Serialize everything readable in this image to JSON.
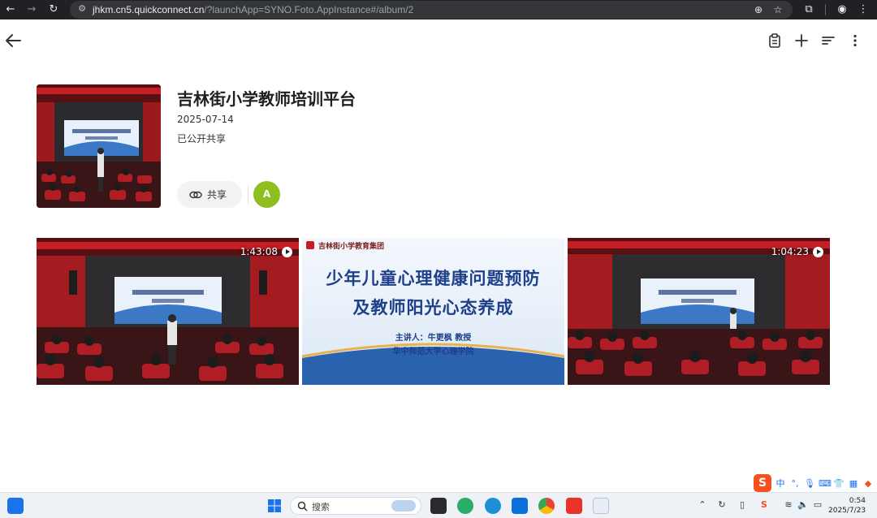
{
  "browser": {
    "url_host": "jhkm.cn5.quickconnect.cn",
    "url_path": "/?launchApp=SYNO.Foto.AppInstance#/album/2"
  },
  "album": {
    "title": "吉林街小学教师培训平台",
    "date": "2025-07-14",
    "share_state": "已公开共享",
    "share_label": "共享",
    "avatar_initial": "A"
  },
  "media": [
    {
      "type": "video",
      "duration": "1:43:08"
    },
    {
      "type": "photo",
      "duration": ""
    },
    {
      "type": "video",
      "duration": "1:04:23"
    }
  ],
  "slide": {
    "org": "吉林街小学教育集团",
    "line1": "少年儿童心理健康问题预防",
    "line2": "及教师阳光心态养成",
    "speaker": "主讲人：牛更枫  教授",
    "affiliation": "华中师范大学心理学院"
  },
  "ime": {
    "logo": "S",
    "mode": "中"
  },
  "taskbar": {
    "search_label": "搜索",
    "time": "0:54",
    "date": "2025/7/23"
  },
  "colors": {
    "avatar": "#8fbf1f",
    "browser_chrome": "#202124",
    "taskbar": "#eef1f6"
  }
}
